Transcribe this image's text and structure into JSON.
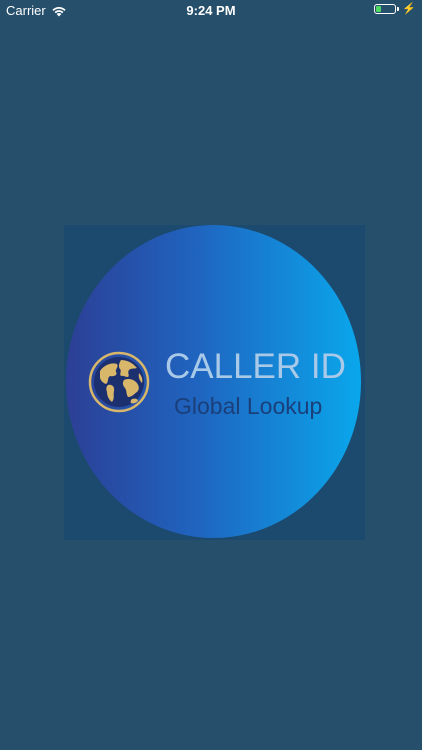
{
  "status_bar": {
    "carrier": "Carrier",
    "time": "9:24 PM",
    "battery_level": 0.3,
    "battery_color": "#4cd964",
    "wifi_icon": "wifi-icon",
    "charging_icon": "bolt-icon",
    "charging_glyph": "⚡"
  },
  "splash": {
    "title": "CALLER ID",
    "subtitle": "Global Lookup",
    "logo_icon": "globe-icon",
    "colors": {
      "background": "#264f6c",
      "square": "#1b4a6e",
      "gradient_start": "#2c3f95",
      "gradient_end": "#0aa7ec",
      "title": "#a9c9e8",
      "subtitle": "#1a3f7a",
      "globe_gold": "#d8b76a"
    }
  }
}
